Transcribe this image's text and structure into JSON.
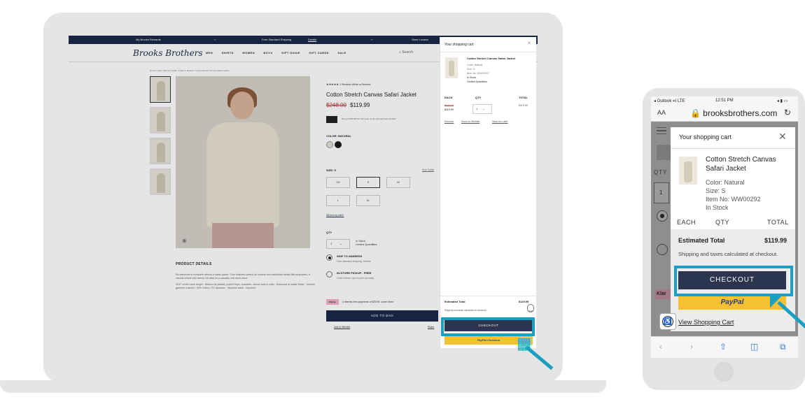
{
  "laptop_site": {
    "topbar": {
      "rewards": "My Brooks Rewards",
      "prev": "<",
      "shipping": "Free Standard Shipping",
      "details": "Details",
      "next": ">",
      "store_locator": "Store Locator"
    },
    "logo": "Brooks Brothers",
    "nav": [
      "MEN",
      "SHIRTS",
      "WOMEN",
      "BOYS",
      "GIFT GUIDE",
      "GIFT CARDS",
      "SALE"
    ],
    "search": "Search",
    "breadcrumb": "Home / Sale / Women's Sale / Coats & Jackets / Cotton Stretch Canvas Safari Jacket",
    "zoom_icon": "⊕",
    "product_details_title": "PRODUCT DETAILS",
    "product_details_text": "No wardrobe is complete without a safari jacket. Ours features stretch for comfort and traditional details like epaulettes, a canvas weave and sleeve roll tabs for a casually chic must-have.",
    "product_details_specs": "28.5\" center back length · Buttons at placket, pocket flaps, epaulette, sleeve tabs & cuffs · Drawcord at inside Waist · Unlined garment washed · 98% Cotton, 2% Spandex · Machine wash · Imported",
    "rating": "★★★★★ 1 Review Write a Review",
    "product_title": "Cotton Stretch Canvas Safari Jacket",
    "price_old": "$248.00",
    "price_new": "$119.99",
    "card_offer": "Pay just $95.98* for this upon credit card approval. Details",
    "color_label": "COLOR: NATURAL",
    "size_label": "SIZE: S",
    "size_guide": "Size Guide",
    "sizes": [
      "XS",
      "S",
      "M",
      "L",
      "XL"
    ],
    "whats_my_size": "What's my size?",
    "qty_label": "QTY",
    "qty_value": "1",
    "stock_status": "In Stock",
    "stock_qty": "Limited Quantities",
    "ship_title": "SHIP TO ADDRESS",
    "ship_sub": "Free standard shipping. Details",
    "pickup_title": "IN-STORE PICKUP - FREE",
    "pickup_sub": "Order before 1pm to pick up today.",
    "klarna_badge": "Klarna.",
    "klarna_text": "4 interest-free payments of $29.99. Learn More",
    "add_to_bag": "ADD TO BAG",
    "add_to_wishlist": "Add to Wishlist",
    "share": "Share"
  },
  "laptop_cart": {
    "title": "Your shopping cart",
    "close": "✕",
    "item_name": "Cotton Stretch Canvas Safari Jacket",
    "item_color": "Color: Natural",
    "item_size": "Size: S",
    "item_no": "Item No: WW00292",
    "item_stock": "In Stock",
    "item_limited": "Limited Quantities",
    "col_each": "EACH",
    "col_qty": "QTY",
    "col_total": "TOTAL",
    "each_old": "$248.00",
    "each_new": "$119.99",
    "qty": "1",
    "total": "$119.99",
    "link_remove": "Remove",
    "link_wishlist": "Move to Wishlist",
    "link_later": "Save for Later",
    "estimated_total_label": "Estimated Total",
    "estimated_total": "$119.99",
    "shipping_note": "Shipping and taxes calculated at checkout.",
    "chat": "chat",
    "checkout": "CHECKOUT",
    "paypal": "PayPal Checkout"
  },
  "phone": {
    "status_carrier": "◂ Outlook ▪ıl LTE",
    "status_time": "12:51 PM",
    "status_right": "◂ ▮ ▭",
    "aa": "AA",
    "url": "🔒 brooksbrothers.com",
    "reload": "↻",
    "bg_qty": "QTY",
    "bg_qty_value": "1",
    "bg_klarna": "Klar",
    "cart_title": "Your shopping cart",
    "cart_close": "✕",
    "item_name": "Cotton Stretch Canvas Safari Jacket",
    "item_color": "Color: Natural",
    "item_size": "Size: S",
    "item_no": "Item No: WW00292",
    "item_stock": "In Stock",
    "col_each": "EACH",
    "col_qty": "QTY",
    "col_total": "TOTAL",
    "estimated_total_label": "Estimated Total",
    "estimated_total": "$119.99",
    "shipping_note": "Shipping and taxes calculated at checkout.",
    "checkout": "CHECKOUT",
    "paypal": "PayPal",
    "view_cart": "View Shopping Cart",
    "toolbar": [
      "‹",
      "›",
      "⇧",
      "◫",
      "⧉"
    ]
  },
  "colors": {
    "navy": "#1b2a4a",
    "checkout": "#2b3550",
    "highlight": "#1a9fc2",
    "paypal": "#f5c131",
    "sale_red": "#b83a3a"
  }
}
